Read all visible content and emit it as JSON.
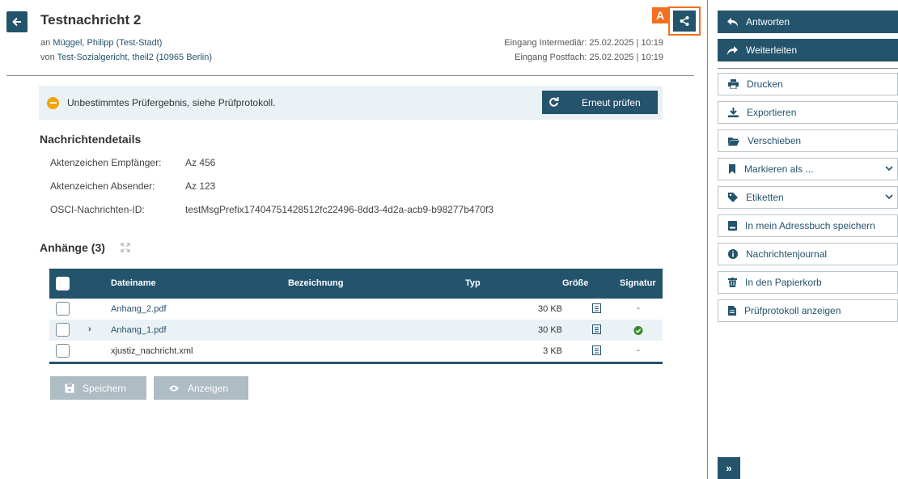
{
  "message": {
    "title": "Testnachricht 2",
    "to_prefix": "an",
    "to_name": "Müggel, Philipp (Test-Stadt)",
    "from_prefix": "von",
    "from_name": "Test-Sozialgericht, theil2 (10965 Berlin)",
    "received_intermediary": "Eingang Intermediär: 25.02.2025 | 10:19",
    "received_mailbox": "Eingang Postfach: 25.02.2025 | 10:19",
    "annotation_badge": "A"
  },
  "status": {
    "text": "Unbestimmtes Prüfergebnis, siehe Prüfprotokoll.",
    "recheck_label": "Erneut prüfen"
  },
  "details": {
    "heading": "Nachrichtendetails",
    "rows": [
      {
        "label": "Aktenzeichen Empfänger:",
        "value": "Az 456"
      },
      {
        "label": "Aktenzeichen Absender:",
        "value": "Az 123"
      },
      {
        "label": "OSCI-Nachrichten-ID:",
        "value": "testMsgPrefix17404751428512fc22496-8dd3-4d2a-acb9-b98277b470f3"
      }
    ]
  },
  "attachments": {
    "heading": "Anhänge (3)",
    "columns": [
      "Dateiname",
      "Bezeichnung",
      "Typ",
      "Größe",
      "Signatur"
    ],
    "rows": [
      {
        "name": "Anhang_2.pdf",
        "size": "30 KB",
        "signature": "-"
      },
      {
        "name": "Anhang_1.pdf",
        "size": "30 KB",
        "signature": "valid"
      },
      {
        "name": "xjustiz_nachricht.xml",
        "size": "3 KB",
        "signature": "-"
      }
    ],
    "save_label": "Speichern",
    "view_label": "Anzeigen"
  },
  "actions": {
    "reply": "Antworten",
    "forward": "Weiterleiten",
    "print": "Drucken",
    "export": "Exportieren",
    "move": "Verschieben",
    "mark_as": "Markieren als ...",
    "labels": "Etiketten",
    "save_address": "In mein Adressbuch speichern",
    "journal": "Nachrichtenjournal",
    "trash": "In den Papierkorb",
    "protocol": "Prüfprotokoll anzeigen"
  },
  "colors": {
    "primary": "#24536c",
    "accent": "#f37021",
    "warning": "#f0a500",
    "success": "#3a8a2e",
    "banner_bg": "#eaf2f6"
  }
}
